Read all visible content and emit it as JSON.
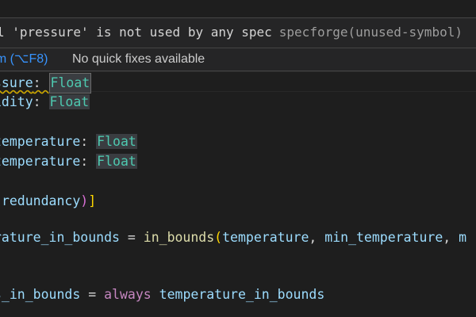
{
  "hover": {
    "message": "l 'pressure' is not used by any spec",
    "source": "specforge(unused-symbol)",
    "view_problem_label": "em (⌥F8)",
    "quick_fix_status": "No quick fixes available"
  },
  "code": {
    "line1": {
      "name": "ssure",
      "colon": ": ",
      "type": "Float"
    },
    "line2": {
      "name": "idity",
      "colon": ": ",
      "type": "Float"
    },
    "line3": {
      "name": "temperature",
      "colon": ": ",
      "type": "Float"
    },
    "line4": {
      "name": "temperature",
      "colon": ": ",
      "type": "Float"
    },
    "line5": {
      "open": "(",
      "text": "redundancy",
      "close": ")",
      "bracket": "]"
    },
    "line6": {
      "lhs": "rature_in_bounds",
      "eq": " = ",
      "fn": "in_bounds",
      "paren": "(",
      "arg1": "temperature",
      "sep": ", ",
      "arg2": "min_temperature",
      "sep2": ", ",
      "arg3": "m"
    },
    "line7": {
      "lhs": "s_in_bounds",
      "eq": " = ",
      "kw": "always",
      "space": " ",
      "rhs": "temperature_in_bounds"
    }
  },
  "colors": {
    "background": "#1e1e1e",
    "type": "#4ec9b0",
    "variable": "#9cdcfe",
    "keyword": "#c586c0",
    "function": "#dcdcaa",
    "link": "#3794ff",
    "warning_squiggle": "#cca700"
  }
}
